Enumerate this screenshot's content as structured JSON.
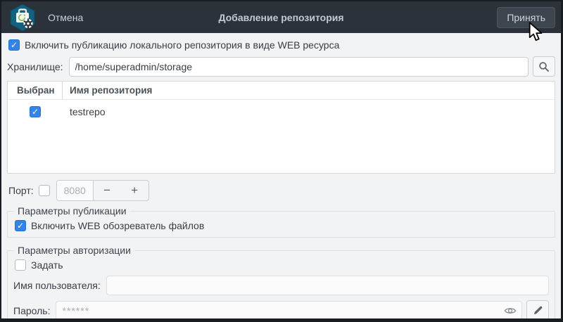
{
  "header": {
    "title": "Добавление репозитория",
    "cancel_label": "Отмена",
    "accept_label": "Принять",
    "app_icon": "repository-manager-icon",
    "bg_color": "#2b323a"
  },
  "colors": {
    "accent_blue": "#3584e4",
    "page_bg": "#f2f3f5",
    "header_bg": "#2b323a",
    "window_border": "#171d23"
  },
  "main": {
    "enable_publication": {
      "label": "Включить публикацию локального репозитория в виде WEB ресурса",
      "checked": true
    },
    "storage": {
      "label": "Хранилище:",
      "value": "/home/superadmin/storage",
      "browse_icon": "search-icon"
    },
    "repo_table": {
      "columns": {
        "selected": "Выбран",
        "name": "Имя репозитория"
      },
      "rows": [
        {
          "selected": true,
          "name": "testrepo"
        }
      ]
    },
    "port": {
      "label": "Порт:",
      "checked": false,
      "value": "8080",
      "minus_label": "−",
      "plus_label": "+"
    },
    "publication_group": {
      "legend": "Параметры публикации",
      "web_browser": {
        "label": "Включить WEB обозреватель файлов",
        "checked": true
      }
    },
    "auth_group": {
      "legend": "Параметры авторизации",
      "set_auth": {
        "label": "Задать",
        "checked": false
      },
      "username": {
        "label": "Имя пользователя:",
        "value": ""
      },
      "password": {
        "label": "Пароль:",
        "value": "******",
        "eye_icon": "eye-icon",
        "edit_icon": "pencil-icon"
      }
    }
  }
}
